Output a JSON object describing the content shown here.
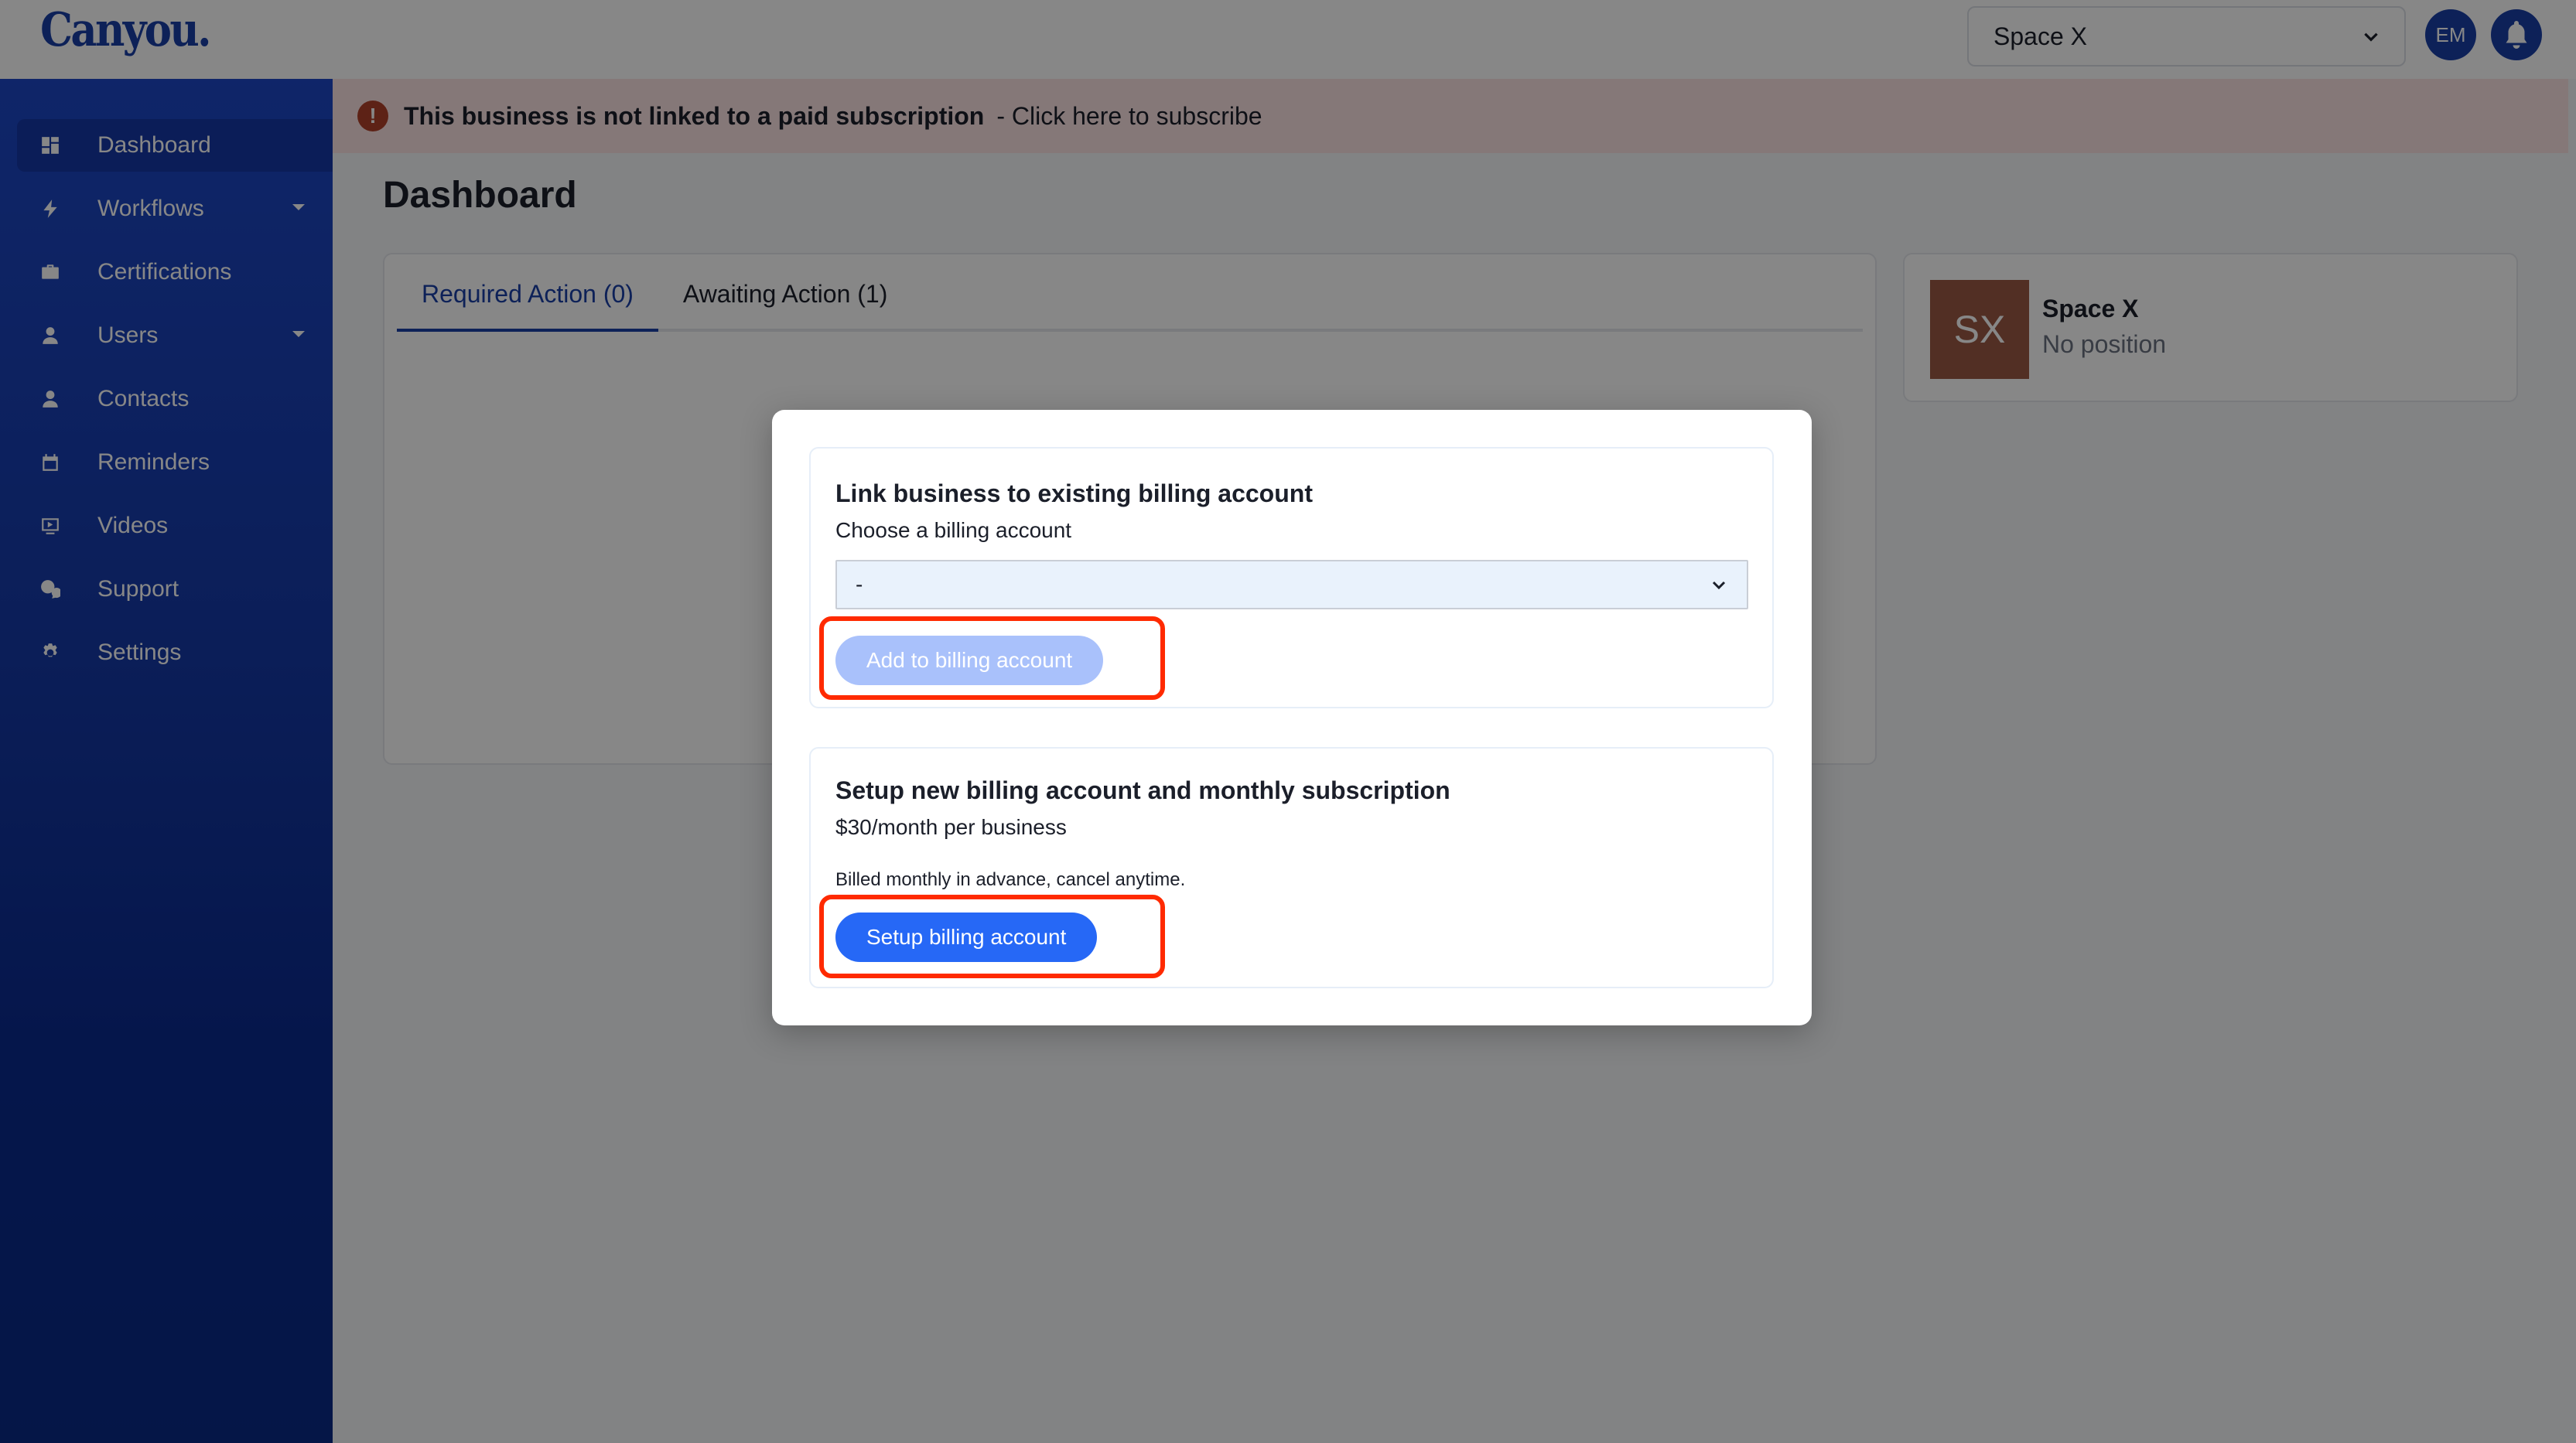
{
  "header": {
    "logo": "Canyou.",
    "org_selector": {
      "value": "Space X",
      "icon": "chevron-down-icon"
    },
    "user_avatar": {
      "initials": "EM"
    },
    "notifications": {
      "icon": "bell-icon"
    }
  },
  "sidebar": {
    "items": [
      {
        "label": "Dashboard",
        "icon": "dashboard-icon",
        "active": true,
        "has_caret": false
      },
      {
        "label": "Workflows",
        "icon": "bolt-icon",
        "active": false,
        "has_caret": true
      },
      {
        "label": "Certifications",
        "icon": "briefcase-icon",
        "active": false,
        "has_caret": false
      },
      {
        "label": "Users",
        "icon": "user-icon",
        "active": false,
        "has_caret": true
      },
      {
        "label": "Contacts",
        "icon": "user-icon",
        "active": false,
        "has_caret": false
      },
      {
        "label": "Reminders",
        "icon": "calendar-icon",
        "active": false,
        "has_caret": false
      },
      {
        "label": "Videos",
        "icon": "video-icon",
        "active": false,
        "has_caret": false
      },
      {
        "label": "Support",
        "icon": "support-chat-icon",
        "active": false,
        "has_caret": false
      },
      {
        "label": "Settings",
        "icon": "gear-icon",
        "active": false,
        "has_caret": false
      }
    ]
  },
  "banner": {
    "icon": "alert-icon",
    "icon_glyph": "!",
    "message": "This business is not linked to a paid subscription",
    "link": "- Click here to subscribe"
  },
  "main": {
    "title": "Dashboard",
    "tabs": [
      {
        "label": "Required Action (0)",
        "active": true
      },
      {
        "label": "Awaiting Action (1)",
        "active": false
      }
    ],
    "profile": {
      "initials": "SX",
      "name": "Space X",
      "position": "No position"
    }
  },
  "modal": {
    "link_section": {
      "title": "Link business to existing billing account",
      "label": "Choose a billing account",
      "select_value": "-",
      "button": "Add to billing account",
      "button_disabled": true
    },
    "setup_section": {
      "title": "Setup new billing account and monthly subscription",
      "price": "$30/month per business",
      "note": "Billed monthly in advance, cancel anytime.",
      "button": "Setup billing account"
    }
  },
  "colors": {
    "brand": "#1a3fa7",
    "primary_button": "#2668f6",
    "disabled_button": "#a9c1fb",
    "highlight": "#ff2a00",
    "avatar_bg": "#9c5a44",
    "banner_bg": "#fbe3e3"
  }
}
